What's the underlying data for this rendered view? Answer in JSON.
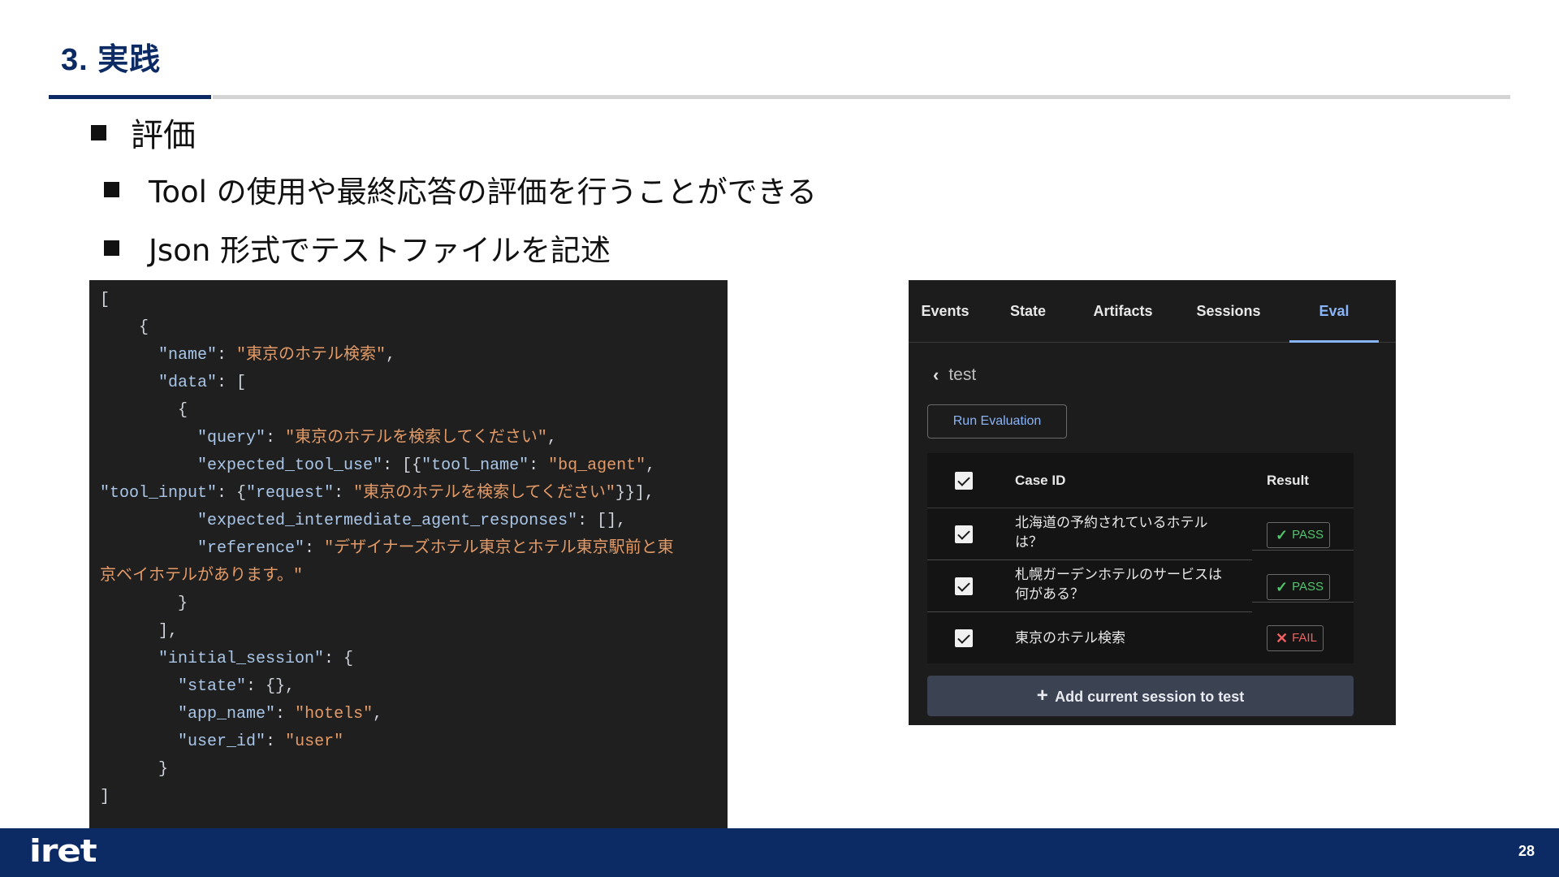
{
  "slide": {
    "title": "3. 実践",
    "bullets": [
      "評価",
      "Tool の使用や最終応答の評価を行うことができる",
      "Json 形式でテストファイルを記述"
    ]
  },
  "code": {
    "lines": [
      [
        {
          "t": "p",
          "v": "["
        }
      ],
      [
        {
          "t": "p",
          "v": "    {"
        }
      ],
      [
        {
          "t": "k",
          "v": "      \"name\""
        },
        {
          "t": "p",
          "v": ": "
        },
        {
          "t": "s",
          "v": "\"東京のホテル検索\""
        },
        {
          "t": "p",
          "v": ","
        }
      ],
      [
        {
          "t": "k",
          "v": "      \"data\""
        },
        {
          "t": "p",
          "v": ": ["
        }
      ],
      [
        {
          "t": "p",
          "v": "        {"
        }
      ],
      [
        {
          "t": "k",
          "v": "          \"query\""
        },
        {
          "t": "p",
          "v": ": "
        },
        {
          "t": "s",
          "v": "\"東京のホテルを検索してください\""
        },
        {
          "t": "p",
          "v": ","
        }
      ],
      [
        {
          "t": "k",
          "v": "          \"expected_tool_use\""
        },
        {
          "t": "p",
          "v": ": [{"
        },
        {
          "t": "k",
          "v": "\"tool_name\""
        },
        {
          "t": "p",
          "v": ": "
        },
        {
          "t": "s",
          "v": "\"bq_agent\""
        },
        {
          "t": "p",
          "v": ","
        }
      ],
      [
        {
          "t": "k",
          "v": "\"tool_input\""
        },
        {
          "t": "p",
          "v": ": {"
        },
        {
          "t": "k",
          "v": "\"request\""
        },
        {
          "t": "p",
          "v": ": "
        },
        {
          "t": "s",
          "v": "\"東京のホテルを検索してください\""
        },
        {
          "t": "p",
          "v": "}}],"
        }
      ],
      [
        {
          "t": "k",
          "v": "          \"expected_intermediate_agent_responses\""
        },
        {
          "t": "p",
          "v": ": [],"
        }
      ],
      [
        {
          "t": "k",
          "v": "          \"reference\""
        },
        {
          "t": "p",
          "v": ": "
        },
        {
          "t": "s",
          "v": "\"デザイナーズホテル東京とホテル東京駅前と東"
        }
      ],
      [
        {
          "t": "s",
          "v": "京ベイホテルがあります。\""
        }
      ],
      [
        {
          "t": "p",
          "v": "        }"
        }
      ],
      [
        {
          "t": "p",
          "v": "      ],"
        }
      ],
      [
        {
          "t": "k",
          "v": "      \"initial_session\""
        },
        {
          "t": "p",
          "v": ": {"
        }
      ],
      [
        {
          "t": "k",
          "v": "        \"state\""
        },
        {
          "t": "p",
          "v": ": {},"
        }
      ],
      [
        {
          "t": "k",
          "v": "        \"app_name\""
        },
        {
          "t": "p",
          "v": ": "
        },
        {
          "t": "s",
          "v": "\"hotels\""
        },
        {
          "t": "p",
          "v": ","
        }
      ],
      [
        {
          "t": "k",
          "v": "        \"user_id\""
        },
        {
          "t": "p",
          "v": ": "
        },
        {
          "t": "s",
          "v": "\"user\""
        }
      ],
      [
        {
          "t": "p",
          "v": "      }"
        }
      ],
      [
        {
          "t": "p",
          "v": "]"
        }
      ]
    ]
  },
  "eval_panel": {
    "tabs": [
      "Events",
      "State",
      "Artifacts",
      "Sessions",
      "Eval"
    ],
    "active_tab": "Eval",
    "back_label": "test",
    "run_button": "Run Evaluation",
    "table": {
      "col_case": "Case ID",
      "col_result": "Result",
      "rows": [
        {
          "case": "北海道の予約されているホテルは？",
          "result": "PASS",
          "status": "pass"
        },
        {
          "case": "札幌ガーデンホテルのサービスは何がある？",
          "result": "PASS",
          "status": "pass"
        },
        {
          "case": "東京のホテル検索",
          "result": "FAIL",
          "status": "fail"
        }
      ]
    },
    "add_button": "Add current session to test"
  },
  "footer": {
    "logo": "iret",
    "page": "28"
  },
  "colors": {
    "brand_navy": "#0c2a63",
    "code_bg": "#1f1f1f",
    "code_key": "#a9c6e8",
    "code_string": "#e39a66",
    "tab_active": "#8ab4f8",
    "pass": "#52c56d",
    "fail": "#f06060"
  }
}
